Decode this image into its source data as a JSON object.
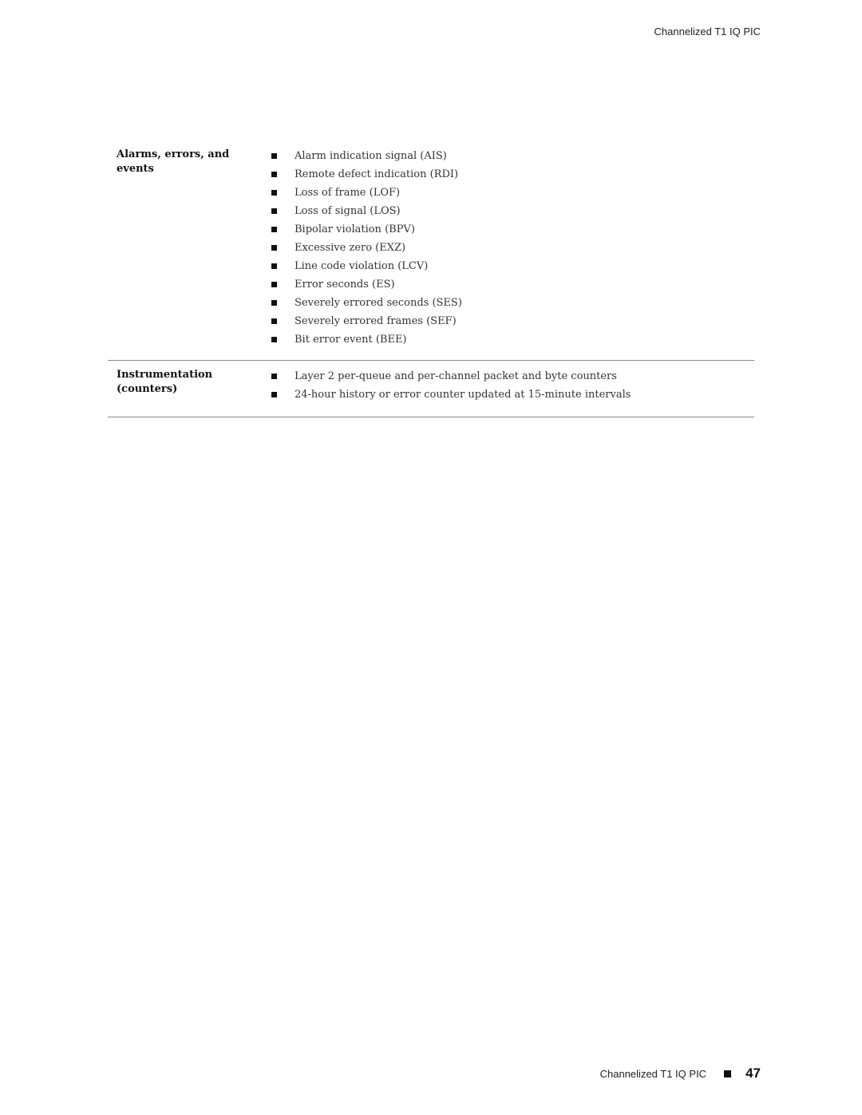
{
  "header": {
    "running_title": "Channelized T1 IQ PIC"
  },
  "table": {
    "rows": [
      {
        "label": "Alarms, errors, and events",
        "items": [
          "Alarm indication signal (AIS)",
          "Remote defect indication (RDI)",
          "Loss of frame (LOF)",
          "Loss of signal (LOS)",
          "Bipolar violation (BPV)",
          "Excessive zero (EXZ)",
          "Line code violation (LCV)",
          "Error seconds (ES)",
          "Severely errored seconds (SES)",
          "Severely errored frames (SEF)",
          "Bit error event (BEE)"
        ]
      },
      {
        "label": "Instrumentation (counters)",
        "items": [
          "Layer 2 per-queue and per-channel packet and byte counters",
          "24-hour history or error counter updated at 15-minute intervals"
        ]
      }
    ]
  },
  "footer": {
    "title": "Channelized T1 IQ PIC",
    "page_number": "47"
  }
}
